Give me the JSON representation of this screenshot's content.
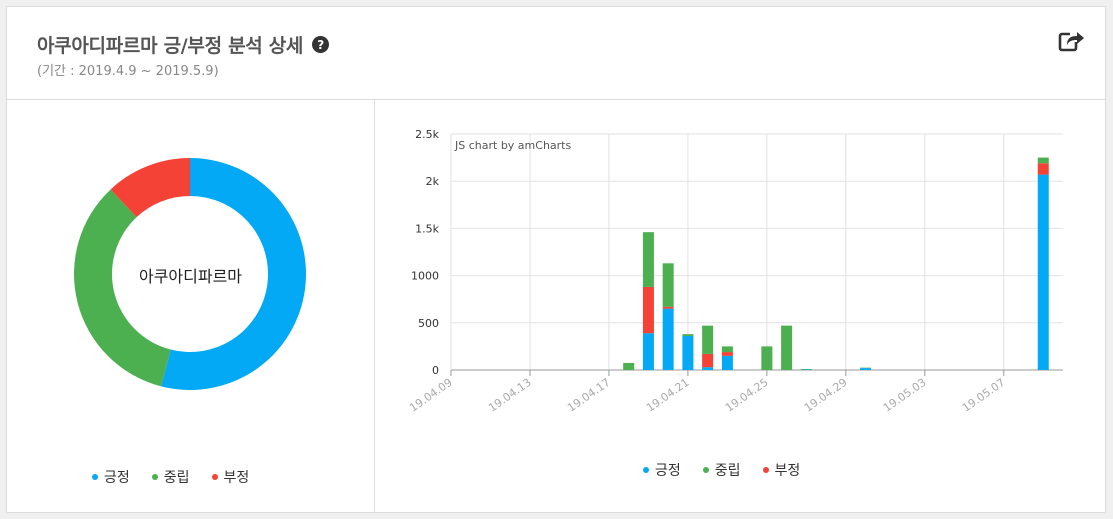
{
  "header": {
    "title": "아쿠아디파르마 긍/부정 분석 상세",
    "help_glyph": "?",
    "period": "(기간 : 2019.4.9 ~ 2019.5.9)"
  },
  "colors": {
    "positive": "#03a9f4",
    "neutral": "#4caf50",
    "negative": "#f44336"
  },
  "legend": [
    {
      "label": "긍정",
      "color": "#03a9f4"
    },
    {
      "label": "중립",
      "color": "#4caf50"
    },
    {
      "label": "부정",
      "color": "#f44336"
    }
  ],
  "chart_data": [
    {
      "type": "pie",
      "center_label": "아쿠아디파르마",
      "categories": [
        "긍정",
        "중립",
        "부정"
      ],
      "values": [
        54,
        34,
        12
      ],
      "colors": [
        "#03a9f4",
        "#4caf50",
        "#f44336"
      ],
      "legend_position": "bottom"
    },
    {
      "type": "bar",
      "stacked": true,
      "credit": "JS chart by amCharts",
      "x_tick_labels": [
        "19.04.09",
        "19.04.13",
        "19.04.17",
        "19.04.21",
        "19.04.25",
        "19.04.29",
        "19.05.03",
        "19.05.07"
      ],
      "y_tick_labels": [
        "0",
        "500",
        "1000",
        "1.5k",
        "2k",
        "2.5k"
      ],
      "ylim": [
        0,
        2500
      ],
      "grid": true,
      "legend_position": "bottom",
      "x": [
        "19.04.18",
        "19.04.19",
        "19.04.20",
        "19.04.21",
        "19.04.22",
        "19.04.23",
        "19.04.25",
        "19.04.26",
        "19.04.27",
        "19.04.30",
        "19.05.09"
      ],
      "series": [
        {
          "name": "긍정",
          "color": "#03a9f4",
          "values": [
            0,
            390,
            650,
            360,
            30,
            150,
            0,
            0,
            5,
            20,
            2070
          ]
        },
        {
          "name": "부정",
          "color": "#f44336",
          "values": [
            0,
            490,
            20,
            0,
            140,
            40,
            0,
            0,
            0,
            0,
            120
          ]
        },
        {
          "name": "중립",
          "color": "#4caf50",
          "values": [
            75,
            580,
            460,
            20,
            300,
            60,
            250,
            470,
            5,
            5,
            60
          ]
        }
      ]
    }
  ]
}
